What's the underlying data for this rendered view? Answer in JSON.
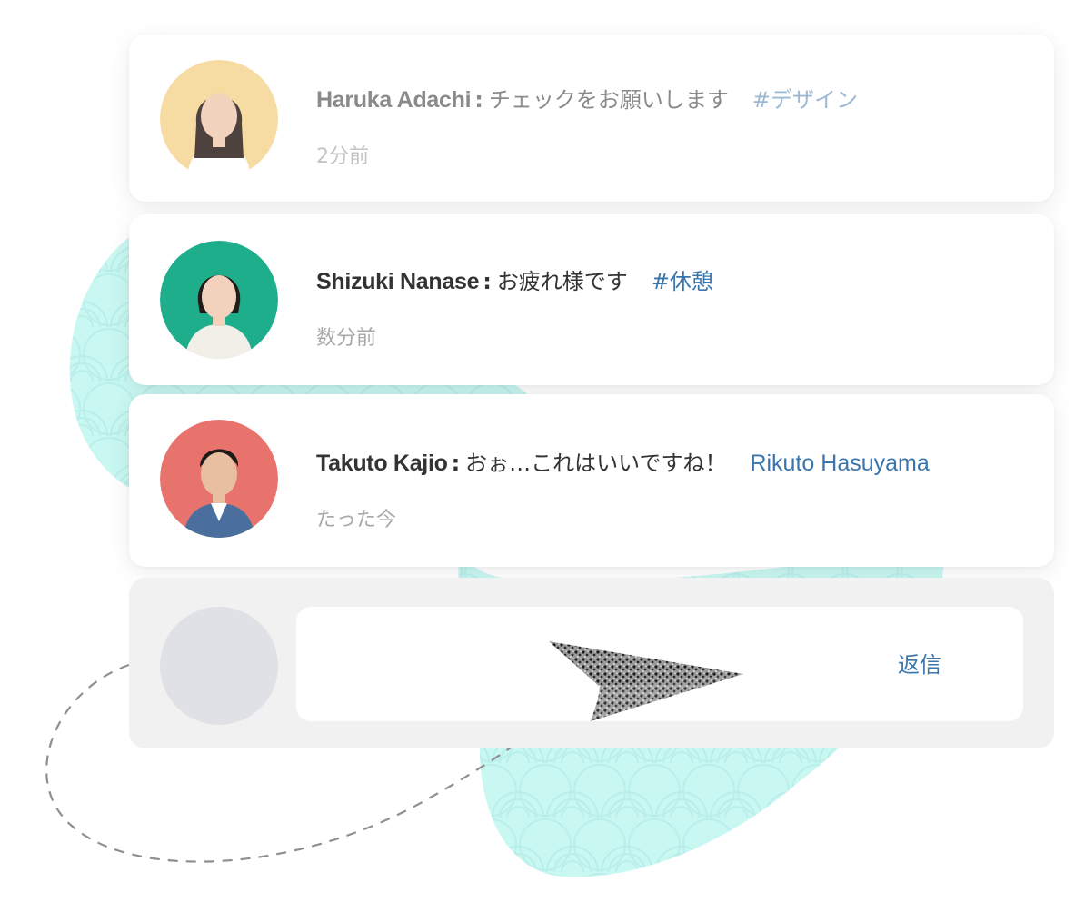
{
  "colors": {
    "accent": "#3a75ad",
    "blob": "#c9f7f2"
  },
  "comments": [
    {
      "name": "Haruka Adachi",
      "separator": ":",
      "message": "チェックをお願いします",
      "tag": "#デザイン",
      "time": "2分前",
      "avatar_bg": "#f6d99a"
    },
    {
      "name": "Shizuki Nanase",
      "separator": ":",
      "message": "お疲れ様です",
      "tag": "#休憩",
      "time": "数分前",
      "avatar_bg": "#1fae8c"
    },
    {
      "name": "Takuto Kajio",
      "separator": ":",
      "message": "おぉ…これはいいですね！",
      "mention": "Rikuto Hasuyama",
      "time": "たった今",
      "avatar_bg": "#e8736d"
    }
  ],
  "reply": {
    "button_label": "返信",
    "send_icon": "paper-plane-icon"
  }
}
